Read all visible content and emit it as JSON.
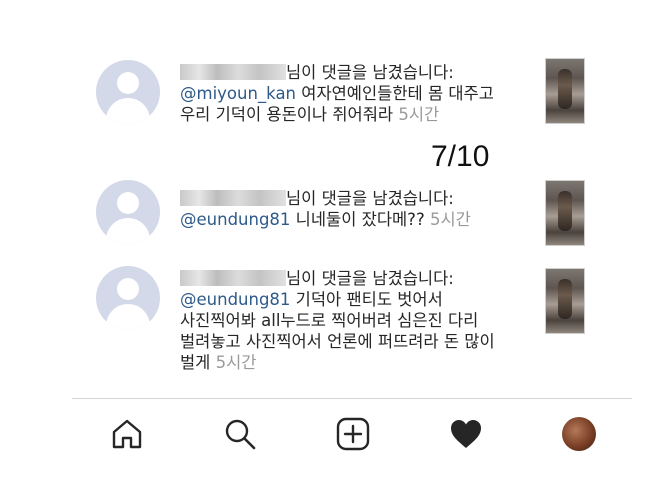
{
  "notifications": [
    {
      "action_text": "님이 댓글을 남겼습니다:",
      "mention": "@miyoun_kan",
      "comment": " 여자연예인들한테 몸 대주고 우리 기덕이 용돈이나 쥐어줘라",
      "time": "5시간"
    },
    {
      "action_text": "님이 댓글을 남겼습니다:",
      "mention": "@eundung81",
      "comment": " 니네둘이 잤다메??",
      "time": "5시간"
    },
    {
      "action_text": "님이 댓글을 남겼습니다:",
      "mention": "@eundung81",
      "comment": " 기덕아 팬티도 벗어서 사진찍어봐 all누드로 찍어버려 심은진 다리 벌려놓고 사진찍어서 언론에 퍼뜨려라 돈 많이 벌게",
      "time": "5시간"
    }
  ],
  "page_counter": "7/10",
  "tabbar": {
    "tabs": [
      "home-icon",
      "search-icon",
      "add-post-icon",
      "activity-heart-icon",
      "profile-avatar"
    ]
  }
}
